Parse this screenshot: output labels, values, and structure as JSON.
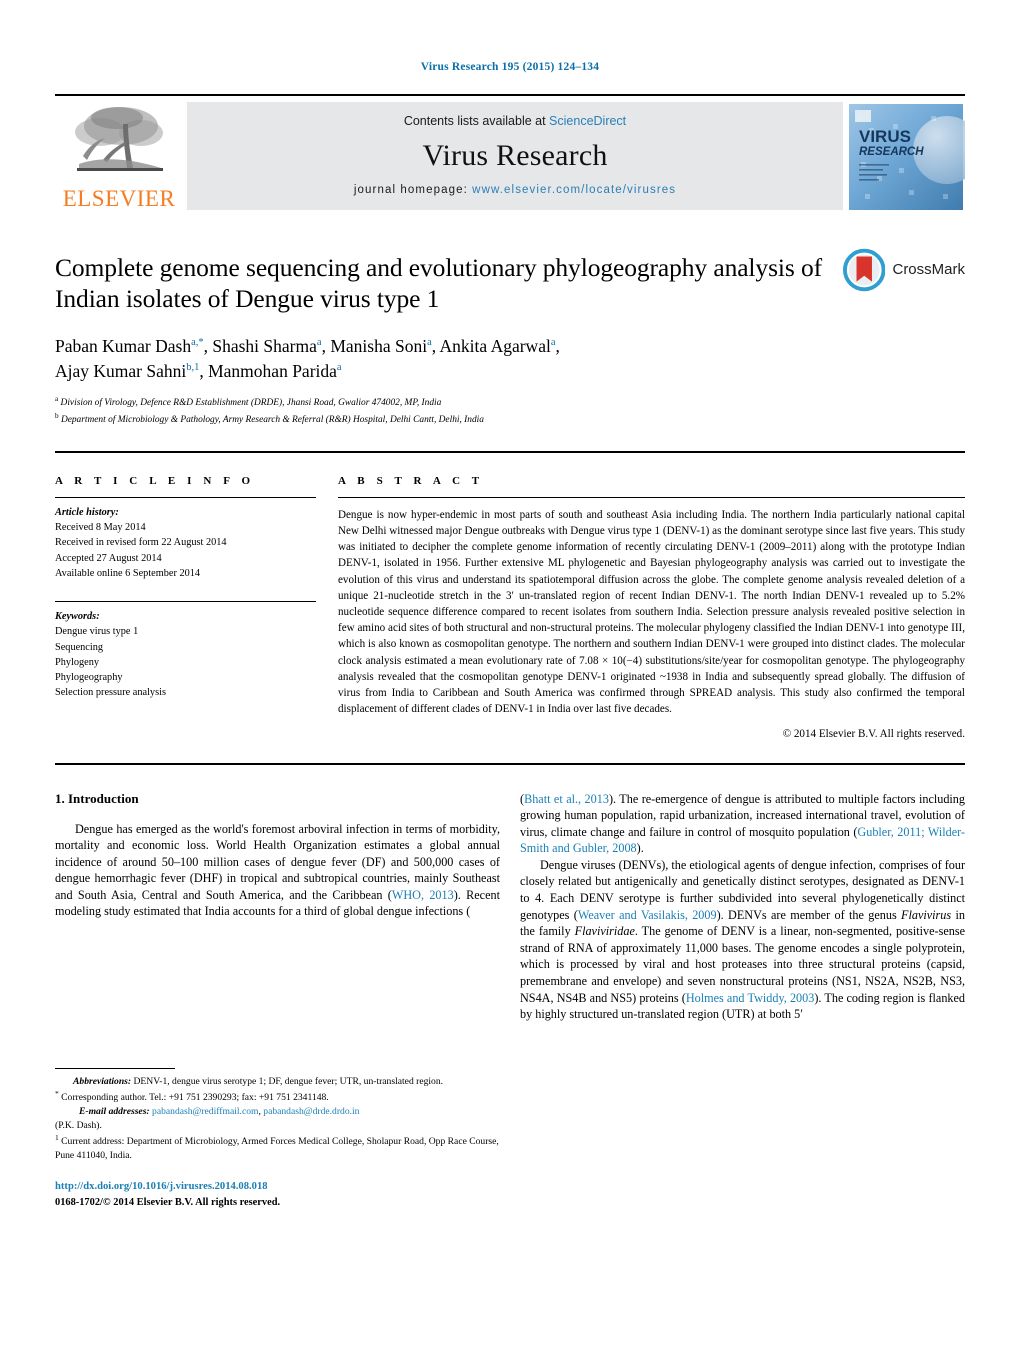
{
  "running_head": "Virus Research 195 (2015) 124–134",
  "masthead": {
    "contents_prefix": "Contents lists available at ",
    "sciencedirect": "ScienceDirect",
    "journal_title": "Virus Research",
    "homepage_prefix": "journal homepage: ",
    "homepage_url": "www.elsevier.com/locate/virusres",
    "publisher_logo_text": "ELSEVIER",
    "cover_title_line1": "VIRUS",
    "cover_title_line2": "RESEARCH",
    "accent_blue": "#2a7fb8",
    "elsevier_orange": "#F57C20"
  },
  "crossmark": {
    "label": "CrossMark"
  },
  "article": {
    "title": "Complete genome sequencing and evolutionary phylogeography analysis of Indian isolates of Dengue virus type 1",
    "authors_line1": [
      {
        "name": "Paban Kumar Dash",
        "sup": "a,*"
      },
      {
        "name": "Shashi Sharma",
        "sup": "a"
      },
      {
        "name": "Manisha Soni",
        "sup": "a"
      },
      {
        "name": "Ankita Agarwal",
        "sup": "a"
      }
    ],
    "authors_line2": [
      {
        "name": "Ajay Kumar Sahni",
        "sup": "b,1"
      },
      {
        "name": "Manmohan Parida",
        "sup": "a"
      }
    ],
    "affiliations": [
      {
        "marker": "a",
        "text": "Division of Virology, Defence R&D Establishment (DRDE), Jhansi Road, Gwalior 474002, MP, India"
      },
      {
        "marker": "b",
        "text": "Department of Microbiology & Pathology, Army Research & Referral (R&R) Hospital, Delhi Cantt, Delhi, India"
      }
    ]
  },
  "article_info": {
    "label": "A R T I C L E    I N F O",
    "history_heading": "Article history:",
    "history": [
      "Received 8 May 2014",
      "Received in revised form 22 August 2014",
      "Accepted 27 August 2014",
      "Available online 6 September 2014"
    ],
    "keywords_heading": "Keywords:",
    "keywords": [
      "Dengue virus type 1",
      "Sequencing",
      "Phylogeny",
      "Phylogeography",
      "Selection pressure analysis"
    ]
  },
  "abstract": {
    "label": "A B S T R A C T",
    "text": "Dengue is now hyper-endemic in most parts of south and southeast Asia including India. The northern India particularly national capital New Delhi witnessed major Dengue outbreaks with Dengue virus type 1 (DENV-1) as the dominant serotype since last five years. This study was initiated to decipher the complete genome information of recently circulating DENV-1 (2009–2011) along with the prototype Indian DENV-1, isolated in 1956. Further extensive ML phylogenetic and Bayesian phylogeography analysis was carried out to investigate the evolution of this virus and understand its spatiotemporal diffusion across the globe. The complete genome analysis revealed deletion of a unique 21-nucleotide stretch in the 3′ un-translated region of recent Indian DENV-1. The north Indian DENV-1 revealed up to 5.2% nucleotide sequence difference compared to recent isolates from southern India. Selection pressure analysis revealed positive selection in few amino acid sites of both structural and non-structural proteins. The molecular phylogeny classified the Indian DENV-1 into genotype III, which is also known as cosmopolitan genotype. The northern and southern Indian DENV-1 were grouped into distinct clades. The molecular clock analysis estimated a mean evolutionary rate of 7.08 × 10(−4) substitutions/site/year for cosmopolitan genotype. The phylogeography analysis revealed that the cosmopolitan genotype DENV-1 originated ~1938 in India and subsequently spread globally. The diffusion of virus from India to Caribbean and South America was confirmed through SPREAD analysis. This study also confirmed the temporal displacement of different clades of DENV-1 in India over last five decades.",
    "copyright": "© 2014 Elsevier B.V. All rights reserved."
  },
  "introduction": {
    "heading": "1.  Introduction",
    "left_para1_a": "Dengue has emerged as the world's foremost arboviral infection in terms of morbidity, mortality and economic loss. World Health Organization estimates a global annual incidence of around 50–100 million cases of dengue fever (DF) and 500,000 cases of dengue hemorrhagic fever (DHF) in tropical and subtropical countries, mainly Southeast and South Asia, Central and South America, and the Caribbean (",
    "ref_who": "WHO, 2013",
    "left_para1_b": "). Recent modeling study estimated that India accounts for a third of global dengue infections (",
    "ref_bhatt": "Bhatt et al., 2013",
    "right_para1_b": "). The re-emergence of dengue is attributed to multiple factors including growing human population, rapid urbanization, increased international travel, evolution of virus, climate change and failure in control of mosquito population (",
    "ref_gubler": "Gubler, 2011;",
    "ref_wilder": "Wilder-Smith and Gubler, 2008",
    "right_para1_c": ").",
    "right_para2_a": "Dengue viruses (DENVs), the etiological agents of dengue infection, comprises of four closely related but antigenically and genetically distinct serotypes, designated as DENV-1 to 4. Each DENV serotype is further subdivided into several phylogenetically distinct genotypes (",
    "ref_weaver": "Weaver and Vasilakis, 2009",
    "right_para2_b": "). DENVs are member of the genus ",
    "genus_flavivirus": "Flavivirus",
    "right_para2_c": " in the family ",
    "family_flaviviridae": "Flaviviridae",
    "right_para2_d": ". The genome of DENV is a linear, non-segmented, positive-sense strand of RNA of approximately 11,000 bases. The genome encodes a single polyprotein, which is processed by viral and host proteases into three structural proteins (capsid, premembrane and envelope) and seven nonstructural proteins (NS1, NS2A, NS2B, NS3, NS4A, NS4B and NS5) proteins (",
    "ref_holmes": "Holmes and Twiddy, 2003",
    "right_para2_e": "). The coding region is flanked by highly structured un-translated region (UTR) at both 5′"
  },
  "footnotes": {
    "abbrev_label": "Abbreviations:",
    "abbrev_text": " DENV-1, dengue virus serotype 1; DF, dengue fever; UTR, un-translated region.",
    "corresponding_marker": "*",
    "corresponding_text": " Corresponding author. Tel.: +91 751 2390293; fax: +91 751 2341148.",
    "email_label": "E-mail addresses:",
    "email1": "pabandash@rediffmail.com",
    "email_sep": ", ",
    "email2": "pabandash@drde.drdo.in",
    "email_suffix": "(P.K. Dash).",
    "current_addr_marker": "1",
    "current_addr_text": " Current address: Department of Microbiology, Armed Forces Medical College, Sholapur Road, Opp Race Course, Pune 411040, India.",
    "doi_url": "http://dx.doi.org/10.1016/j.virusres.2014.08.018",
    "issn_line": "0168-1702/© 2014 Elsevier B.V. All rights reserved."
  }
}
